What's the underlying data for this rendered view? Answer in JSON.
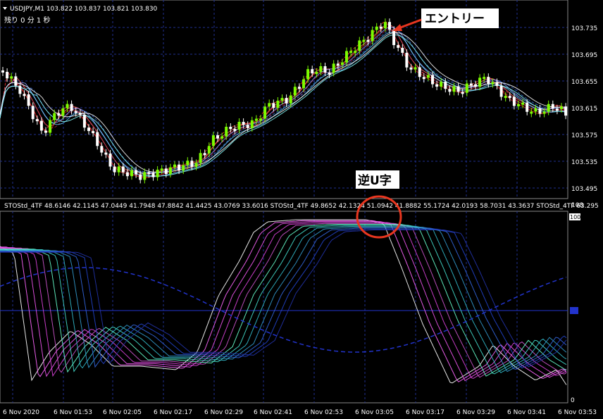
{
  "window": {
    "title": "USDJPY,M1  103.822 103.837 103.821 103.830",
    "timer": "残り 0 分 1 秒",
    "menu_icon": "triangle-down-icon"
  },
  "price_axis": {
    "ticks": [
      "103.735",
      "103.695",
      "103.655",
      "103.615",
      "103.575",
      "103.535",
      "103.495"
    ],
    "current": "103.830"
  },
  "indicator": {
    "caption": "STOStd_4TF 48.6146 42.1145 47.0449 41.7948 47.8842 41.4425 43.0769 33.6016   STOStd_4TF 49.8652 42.1324 51.0942 41.8882 55.1724 42.0193 58.7031 43.3637   STOStd_4TF 63.295",
    "ticks": [
      "100",
      "0"
    ],
    "top_label": "108"
  },
  "time_axis": {
    "ticks": [
      "6 Nov 2020",
      "6 Nov 01:53",
      "6 Nov 02:05",
      "6 Nov 02:17",
      "6 Nov 02:29",
      "6 Nov 02:41",
      "6 Nov 02:53",
      "6 Nov 03:05",
      "6 Nov 03:17",
      "6 Nov 03:29",
      "6 Nov 03:41",
      "6 Nov 03:53"
    ]
  },
  "annotations": {
    "entry": "エントリー",
    "reverse_u": "逆U字"
  },
  "colors": {
    "background": "#000000",
    "bull_candle": "#7cfc00",
    "bear_candle": "#ffffff",
    "grid": "#1f2f8f",
    "annotation_red": "#e8361f"
  }
}
